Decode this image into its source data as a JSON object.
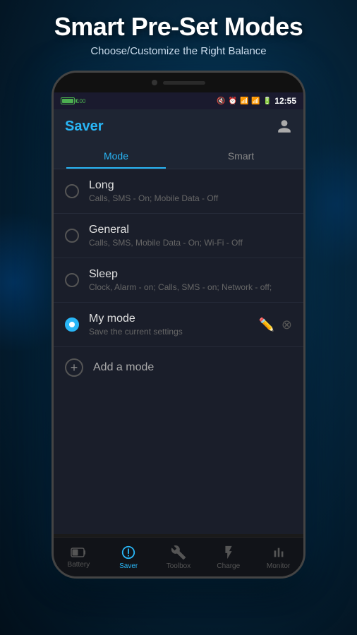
{
  "page": {
    "title": "Smart Pre-Set Modes",
    "subtitle": "Choose/Customize the Right Balance"
  },
  "status_bar": {
    "battery_text": "100",
    "time": "12:55"
  },
  "app_bar": {
    "title": "Saver"
  },
  "tabs": [
    {
      "label": "Mode",
      "active": true
    },
    {
      "label": "Smart",
      "active": false
    }
  ],
  "modes": [
    {
      "name": "Long",
      "desc": "Calls, SMS - On; Mobile Data - Off",
      "active": false
    },
    {
      "name": "General",
      "desc": "Calls, SMS, Mobile Data - On; Wi-Fi - Off",
      "active": false
    },
    {
      "name": "Sleep",
      "desc": "Clock, Alarm - on; Calls, SMS - on; Network - off;",
      "active": false
    },
    {
      "name": "My mode",
      "desc": "Save the current settings",
      "active": true
    }
  ],
  "add_mode_label": "Add a mode",
  "bottom_nav": [
    {
      "label": "Battery",
      "icon": "battery",
      "active": false
    },
    {
      "label": "Saver",
      "icon": "saver",
      "active": true
    },
    {
      "label": "Toolbox",
      "icon": "toolbox",
      "active": false
    },
    {
      "label": "Charge",
      "icon": "charge",
      "active": false
    },
    {
      "label": "Monitor",
      "icon": "monitor",
      "active": false
    }
  ],
  "page_labels": {
    "left": "Battery",
    "right": "Charge"
  }
}
